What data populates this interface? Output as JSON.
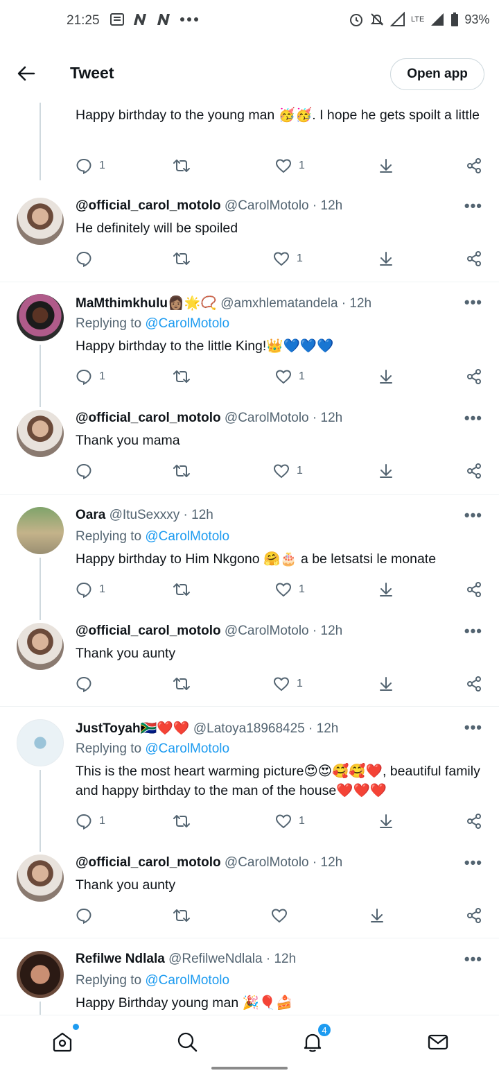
{
  "status_bar": {
    "time": "21:25",
    "battery": "93%",
    "network": "LTE"
  },
  "header": {
    "title": "Tweet",
    "open_app": "Open app"
  },
  "replies": [
    {
      "text": "Happy birthday to the young man 🥳🥳. I hope he gets spoilt a little",
      "counts": {
        "reply": "1",
        "like": "1"
      }
    },
    {
      "name": "@official_carol_motolo",
      "handle": "@CarolMotolo",
      "time": "· 12h",
      "text": "He definitely will be spoiled",
      "counts": {
        "reply": "",
        "like": "1"
      }
    },
    {
      "name": "MaMthimkhulu👩🏽🌟📿",
      "handle": "@amxhlematandela",
      "time": "· 12h",
      "replying_prefix": "Replying to",
      "replying_to": "@CarolMotolo",
      "text": "Happy birthday to the little King!👑💙💙💙",
      "counts": {
        "reply": "1",
        "like": "1"
      }
    },
    {
      "name": "@official_carol_motolo",
      "handle": "@CarolMotolo",
      "time": "· 12h",
      "text": "Thank you mama",
      "counts": {
        "reply": "",
        "like": "1"
      }
    },
    {
      "name": "Oara",
      "handle": "@ItuSexxxy",
      "time": "· 12h",
      "replying_prefix": "Replying to",
      "replying_to": "@CarolMotolo",
      "text": "Happy birthday to Him Nkgono 🤗🎂 a be letsatsi le monate",
      "counts": {
        "reply": "1",
        "like": "1"
      }
    },
    {
      "name": "@official_carol_motolo",
      "handle": "@CarolMotolo",
      "time": "· 12h",
      "text": "Thank you aunty",
      "counts": {
        "reply": "",
        "like": "1"
      }
    },
    {
      "name": "JustToyah🇿🇦❤️❤️",
      "handle": "@Latoya18968425",
      "time": "· 12h",
      "replying_prefix": "Replying to",
      "replying_to": "@CarolMotolo",
      "text": "This is the most heart warming picture😍😍🥰🥰❤️, beautiful family and happy birthday to the man of the house❤️❤️❤️",
      "counts": {
        "reply": "1",
        "like": "1"
      }
    },
    {
      "name": "@official_carol_motolo",
      "handle": "@CarolMotolo",
      "time": "· 12h",
      "text": "Thank you aunty",
      "counts": {
        "reply": "",
        "like": ""
      }
    },
    {
      "name": "Refilwe Ndlala",
      "handle": "@RefilweNdlala",
      "time": "· 12h",
      "replying_prefix": "Replying to",
      "replying_to": "@CarolMotolo",
      "text": "Happy Birthday young man 🎉🎈🍰"
    }
  ],
  "bottom_nav": {
    "notifications_badge": "4"
  },
  "colors": {
    "accent": "#1d9bf0",
    "text": "#0f1419",
    "muted": "#536471",
    "divider": "#eff3f4"
  }
}
